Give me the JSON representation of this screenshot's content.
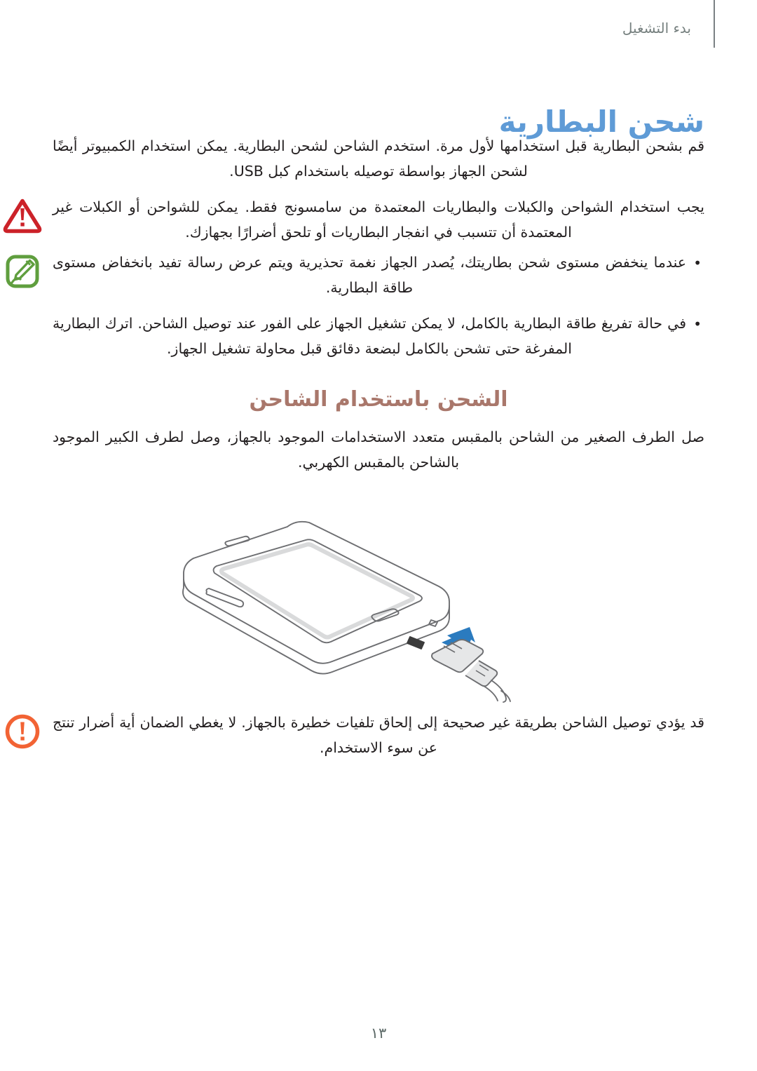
{
  "header": {
    "chapter_label": "بدء التشغيل"
  },
  "title": "شحن البطارية",
  "intro": {
    "paragraph1": "قم بشحن البطارية قبل استخدامها لأول مرة. استخدم الشاحن لشحن البطارية. يمكن استخدام الكمبيوتر أيضًا لشحن الجهاز بواسطة توصيله باستخدام كبل USB."
  },
  "warning_callout": {
    "icon": "warning-triangle-icon",
    "icon_color": "#cc2229",
    "text": "يجب استخدام الشواحن والكبلات والبطاريات المعتمدة من سامسونج فقط. يمكن للشواحن أو الكبلات غير المعتمدة أن تتسبب في انفجار البطاريات أو تلحق أضرارًا بجهازك."
  },
  "note_callout": {
    "icon": "note-pencil-icon",
    "icon_color": "#5f9e3e",
    "bullets": [
      "عندما ينخفض مستوى شحن بطاريتك، يُصدر الجهاز نغمة تحذيرية ويتم عرض رسالة تفيد بانخفاض مستوى طاقة البطارية.",
      "في حالة تفريغ طاقة البطارية بالكامل، لا يمكن تشغيل الجهاز على الفور عند توصيل الشاحن. اترك البطارية المفرغة حتى تشحن بالكامل لبضعة دقائق قبل محاولة تشغيل الجهاز."
    ]
  },
  "section": {
    "subtitle": "الشحن باستخدام الشاحن",
    "paragraph": "صل الطرف الصغير من الشاحن بالمقبس متعدد الاستخدامات الموجود بالجهاز، وصل لطرف الكبير الموجود بالشاحن بالمقبس الكهربي."
  },
  "figure": {
    "alt_name": "phone-usb-charging-illustration",
    "arrow_color": "#2b7bbf",
    "device_outline_color": "#6d6e71"
  },
  "caution_callout": {
    "icon": "caution-circle-icon",
    "icon_color": "#f26334",
    "text": "قد يؤدي توصيل الشاحن بطريقة غير صحيحة إلى إلحاق تلفيات خطيرة بالجهاز. لا يغطي الضمان أية أضرار تنتج عن سوء الاستخدام."
  },
  "page_number": "١٣",
  "colors": {
    "title_blue": "#5f9bd6",
    "subtitle_brown": "#a9776b",
    "header_gray": "#76807f",
    "body_black": "#231f20"
  }
}
